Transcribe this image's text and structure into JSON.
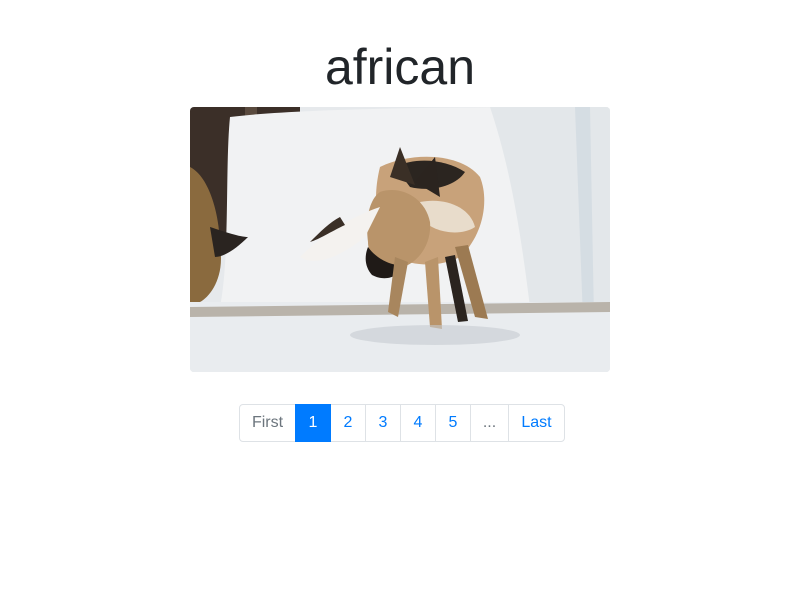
{
  "heading": "african",
  "image": {
    "icon": "african-wild-dog-photo"
  },
  "pagination": {
    "first_label": "First",
    "pages": [
      "1",
      "2",
      "3",
      "4",
      "5"
    ],
    "active_page": "1",
    "ellipsis": "...",
    "last_label": "Last"
  },
  "colors": {
    "link": "#007bff",
    "active_bg": "#007bff",
    "muted": "#6c757d",
    "border": "#dee2e6",
    "heading": "#212529"
  }
}
